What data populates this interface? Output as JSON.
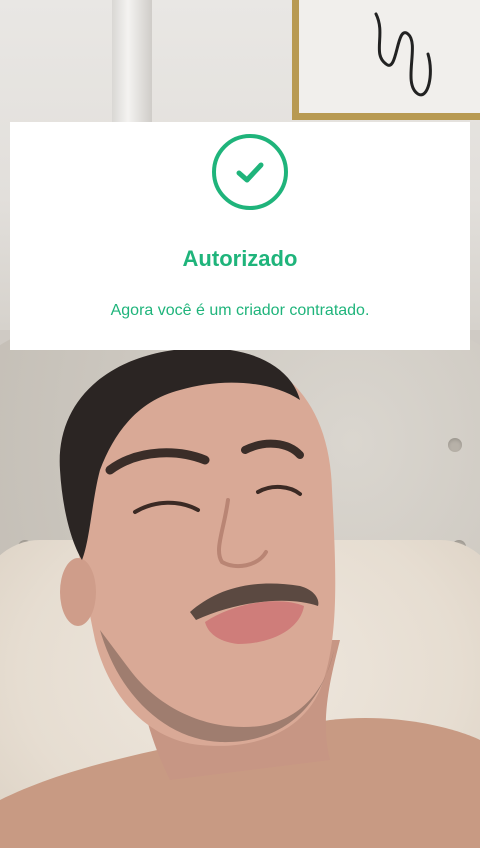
{
  "dialog": {
    "icon": "checkmark-circle-icon",
    "title": "Autorizado",
    "message": "Agora você é um criador contratado."
  },
  "colors": {
    "accent": "#1fb47b",
    "card_background": "#ffffff"
  },
  "background": {
    "description_icon": "video-frame"
  }
}
